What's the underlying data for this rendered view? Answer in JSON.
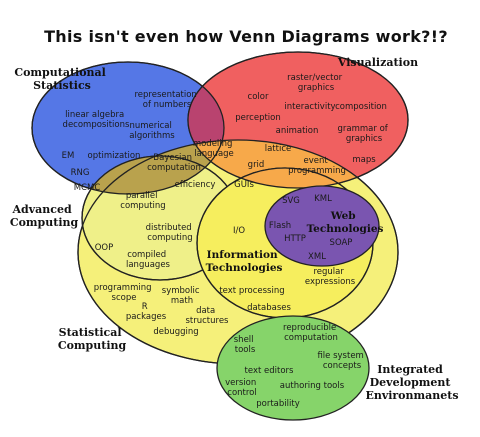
{
  "title": "This isn't even how Venn Diagrams work?!?",
  "colors": {
    "computational_statistics": "#5577e6",
    "visualization": "#f06060",
    "advanced_computing": "#eff089",
    "statistical_computing": "#f5f07a",
    "information_technologies": "#f6ee5e",
    "web_technologies": "#7a55b0",
    "integrated_development": "#86d46a",
    "modeling_overlap": "#b9436f",
    "bayesian_overlap": "#b9a24d",
    "lattice_overlap": "#f7a94a"
  },
  "regions": {
    "computational_statistics": {
      "label_line1": "Computational",
      "label_line2": "Statistics"
    },
    "visualization": {
      "label": "Visualization"
    },
    "advanced_computing": {
      "label_line1": "Advanced",
      "label_line2": "Computing"
    },
    "statistical_computing": {
      "label_line1": "Statistical",
      "label_line2": "Computing"
    },
    "information_technologies": {
      "label_line1": "Information",
      "label_line2": "Technologies"
    },
    "web_technologies": {
      "label_line1": "Web",
      "label_line2": "Technologies"
    },
    "integrated_development": {
      "label_line1": "Integrated",
      "label_line2": "Development",
      "label_line3": "Environmanets"
    }
  },
  "terms": {
    "representation_of_numbers": [
      "representation",
      "of numbers"
    ],
    "linear_algebra_decompositions": [
      "linear algebra",
      "decompositions"
    ],
    "numerical_algorithms": [
      "numerical",
      "algorithms"
    ],
    "em": "EM",
    "optimization": "optimization",
    "rng": "RNG",
    "mcmc": "MCMC",
    "bayesian_computation": [
      "Bayesian",
      "computation"
    ],
    "efficiency": "efficiency",
    "modeling_language": [
      "modeling",
      "language"
    ],
    "raster_vector_graphics": [
      "raster/vector",
      "graphics"
    ],
    "color": "color",
    "interactivity": "interactivity",
    "composition": "composition",
    "perception": "perception",
    "animation": "animation",
    "grammar_of_graphics": [
      "grammar of",
      "graphics"
    ],
    "lattice": "lattice",
    "grid": "grid",
    "event_programming": [
      "event",
      "programming"
    ],
    "maps": "maps",
    "guis": "GUIs",
    "svg": "SVG",
    "kml": "KML",
    "flash": "Flash",
    "http": "HTTP",
    "soap": "SOAP",
    "xml": "XML",
    "parallel_computing": [
      "parallel",
      "computing"
    ],
    "distributed_computing": [
      "distributed",
      "computing"
    ],
    "oop": "OOP",
    "compiled_languages": [
      "compiled",
      "languages"
    ],
    "io": "I/O",
    "regular_expressions": [
      "regular",
      "expressions"
    ],
    "text_processing": "text processing",
    "databases": "databases",
    "programming_scope": [
      "programming",
      "scope"
    ],
    "symbolic_math": [
      "symbolic",
      "math"
    ],
    "r_packages": [
      "R",
      "packages"
    ],
    "data_structures": [
      "data",
      "structures"
    ],
    "debugging": "debugging",
    "shell_tools": [
      "shell",
      "tools"
    ],
    "reproducible_computation": [
      "reproducible",
      "computation"
    ],
    "file_system_concepts": [
      "file system",
      "concepts"
    ],
    "text_editors": "text editors",
    "version_control": [
      "version",
      "control"
    ],
    "authoring_tools": "authoring tools",
    "portability": "portability"
  }
}
